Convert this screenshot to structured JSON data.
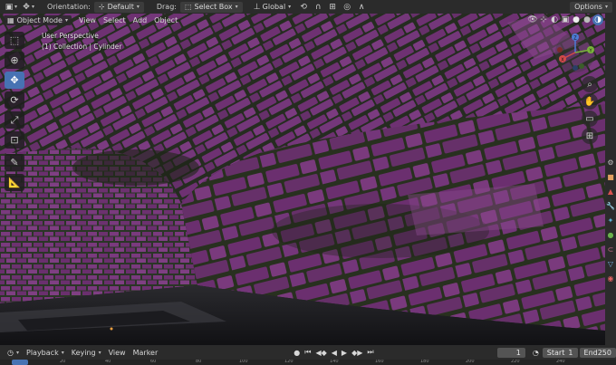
{
  "topbar": {
    "orientation_label": "Orientation:",
    "orientation_value": "Default",
    "drag_label": "Drag:",
    "drag_value": "Select Box",
    "transform_value": "Global",
    "options_label": "Options"
  },
  "viewport_header": {
    "mode": "Object Mode",
    "menus": [
      "View",
      "Select",
      "Add",
      "Object"
    ]
  },
  "viewport": {
    "perspective": "User Perspective",
    "collection": "(1) Collection | Cylinder"
  },
  "tools": [
    "select-box",
    "cursor",
    "move",
    "rotate",
    "scale",
    "transform",
    "annotate",
    "measure"
  ],
  "navigation": {
    "gizmo_axes": [
      "X",
      "Y",
      "Z"
    ]
  },
  "timeline": {
    "menus": [
      "Playback",
      "Keying",
      "View",
      "Marker"
    ],
    "current_frame": "1",
    "start_label": "Start",
    "start_value": "1",
    "end_label": "End",
    "end_value": "250"
  },
  "ruler_ticks": [
    "20",
    "40",
    "60",
    "80",
    "100",
    "120",
    "140",
    "160",
    "180",
    "200",
    "220",
    "240"
  ],
  "colors": {
    "brick": "#6a2f6e",
    "brick_light": "#8a4a8c",
    "mortar": "#2c3a2a",
    "active_tool": "#4772b3"
  }
}
